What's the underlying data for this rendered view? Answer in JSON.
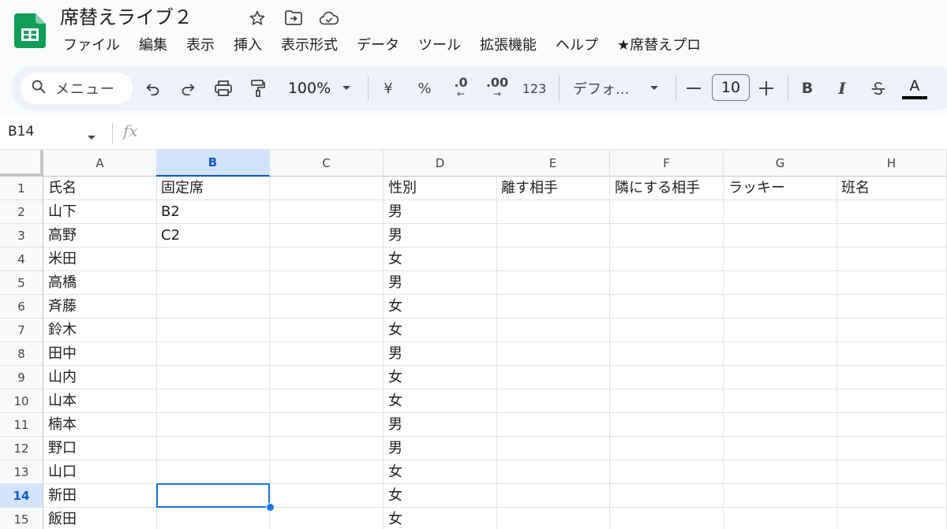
{
  "window": {
    "doc_title": "席替えライブ２",
    "menu": [
      "ファイル",
      "編集",
      "表示",
      "挿入",
      "表示形式",
      "データ",
      "ツール",
      "拡張機能",
      "ヘルプ",
      "★席替えプロ"
    ]
  },
  "toolbar": {
    "search_label": "メニュー",
    "zoom": "100%",
    "currency_label": "¥",
    "percent_label": "%",
    "decrease_decimal_label": ".0",
    "increase_decimal_label": ".00",
    "number_format_label": "123",
    "font_name": "デフォ...",
    "font_size": "10",
    "bold_label": "B",
    "italic_label": "I",
    "text_color_label": "A"
  },
  "formula_bar": {
    "cell_ref": "B14",
    "fx_label": "fx",
    "value": ""
  },
  "sheet": {
    "columns": [
      "A",
      "B",
      "C",
      "D",
      "E",
      "F",
      "G",
      "H"
    ],
    "selected_column": "B",
    "selected_row": 14,
    "rows": [
      {
        "num": "1",
        "cells": [
          "氏名",
          "固定席",
          "",
          "性別",
          "離す相手",
          "隣にする相手",
          "ラッキー",
          "班名"
        ]
      },
      {
        "num": "2",
        "cells": [
          "山下",
          "B2",
          "",
          "男",
          "",
          "",
          "",
          ""
        ]
      },
      {
        "num": "3",
        "cells": [
          "高野",
          "C2",
          "",
          "男",
          "",
          "",
          "",
          ""
        ]
      },
      {
        "num": "4",
        "cells": [
          "米田",
          "",
          "",
          "女",
          "",
          "",
          "",
          ""
        ]
      },
      {
        "num": "5",
        "cells": [
          "高橋",
          "",
          "",
          "男",
          "",
          "",
          "",
          ""
        ]
      },
      {
        "num": "6",
        "cells": [
          "斉藤",
          "",
          "",
          "女",
          "",
          "",
          "",
          ""
        ]
      },
      {
        "num": "7",
        "cells": [
          "鈴木",
          "",
          "",
          "女",
          "",
          "",
          "",
          ""
        ]
      },
      {
        "num": "8",
        "cells": [
          "田中",
          "",
          "",
          "男",
          "",
          "",
          "",
          ""
        ]
      },
      {
        "num": "9",
        "cells": [
          "山内",
          "",
          "",
          "女",
          "",
          "",
          "",
          ""
        ]
      },
      {
        "num": "10",
        "cells": [
          "山本",
          "",
          "",
          "女",
          "",
          "",
          "",
          ""
        ]
      },
      {
        "num": "11",
        "cells": [
          "楠本",
          "",
          "",
          "男",
          "",
          "",
          "",
          ""
        ]
      },
      {
        "num": "12",
        "cells": [
          "野口",
          "",
          "",
          "男",
          "",
          "",
          "",
          ""
        ]
      },
      {
        "num": "13",
        "cells": [
          "山口",
          "",
          "",
          "女",
          "",
          "",
          "",
          ""
        ]
      },
      {
        "num": "14",
        "cells": [
          "新田",
          "",
          "",
          "女",
          "",
          "",
          "",
          ""
        ]
      },
      {
        "num": "15",
        "cells": [
          "飯田",
          "",
          "",
          "女",
          "",
          "",
          "",
          ""
        ]
      }
    ]
  },
  "colors": {
    "sheets_green": "#0f9d58",
    "selection_blue": "#1a73e8",
    "toolbar_bg": "#edf2fa",
    "header_bg": "#f8f9fa"
  }
}
